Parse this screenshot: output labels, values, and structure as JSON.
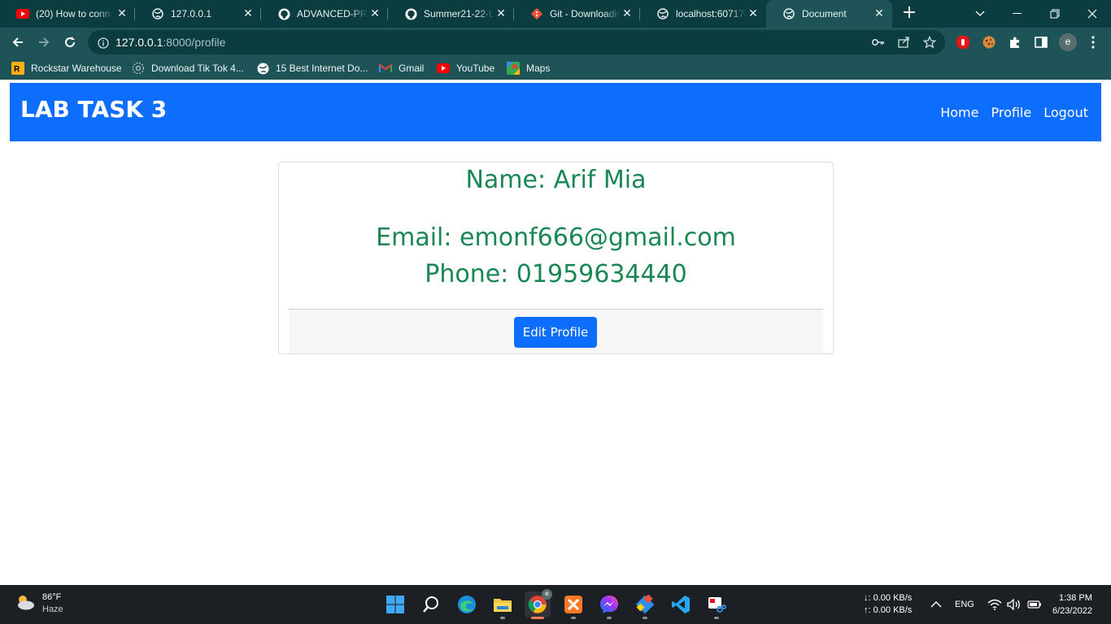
{
  "browser": {
    "tabs": [
      {
        "label": "(20) How to conn",
        "icon": "youtube-icon"
      },
      {
        "label": "127.0.0.1",
        "icon": "globe-icon"
      },
      {
        "label": "ADVANCED-PRO",
        "icon": "github-icon"
      },
      {
        "label": "Summer21-22-La",
        "icon": "github-icon"
      },
      {
        "label": "Git - Downloadin",
        "icon": "git-icon"
      },
      {
        "label": "localhost:60717/",
        "icon": "globe-icon"
      },
      {
        "label": "Document",
        "icon": "globe-icon",
        "active": true
      }
    ],
    "url_host": "127.0.0.1",
    "url_path": ":8000/profile",
    "profile_initial": "e",
    "bookmarks": [
      {
        "label": "Rockstar Warehouse",
        "icon": "rockstar-icon"
      },
      {
        "label": "Download Tik Tok 4...",
        "icon": "globe-dotted-icon"
      },
      {
        "label": "15 Best Internet Do...",
        "icon": "globe-icon"
      },
      {
        "label": "Gmail",
        "icon": "gmail-icon"
      },
      {
        "label": "YouTube",
        "icon": "youtube-icon"
      },
      {
        "label": "Maps",
        "icon": "maps-icon"
      }
    ]
  },
  "app": {
    "brand": "LAB TASK 3",
    "nav": {
      "home": "Home",
      "profile": "Profile",
      "logout": "Logout"
    },
    "profile": {
      "name_line": "Name: Arif Mia",
      "email_line": "Email: emonf666@gmail.com",
      "phone_line": "Phone: 01959634440",
      "edit_button": "Edit Profile"
    },
    "colors": {
      "navbar": "#0d6efd",
      "text_success": "#198754",
      "button": "#0d6efd"
    }
  },
  "taskbar": {
    "weather_temp": "86°F",
    "weather_desc": "Haze",
    "net_down": "↓: 0.00 KB/s",
    "net_up": "↑: 0.00 KB/s",
    "language": "ENG",
    "time": "1:38 PM",
    "date": "6/23/2022"
  }
}
